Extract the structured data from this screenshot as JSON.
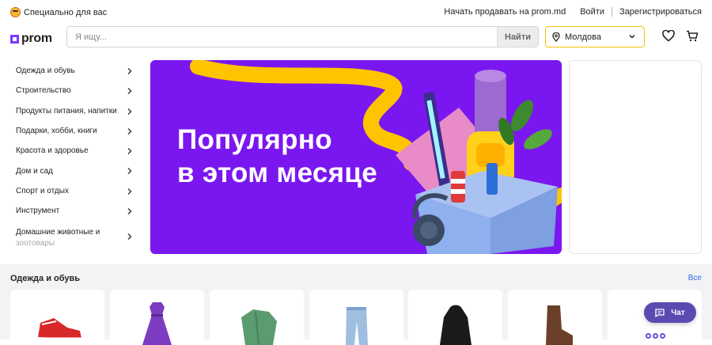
{
  "topbar": {
    "special_label": "Специально для вас",
    "sell_label": "Начать продавать на prom.md",
    "login_label": "Войти",
    "register_label": "Зарегистрироваться"
  },
  "header": {
    "logo_text": "prom",
    "search_placeholder": "Я ищу...",
    "search_button": "Найти",
    "region": "Молдова"
  },
  "categories": [
    {
      "label": "Одежда и обувь"
    },
    {
      "label": "Строительство"
    },
    {
      "label": "Продукты питания, напитки"
    },
    {
      "label": "Подарки, хобби, книги"
    },
    {
      "label": "Красота и здоровье"
    },
    {
      "label": "Дом и сад"
    },
    {
      "label": "Спорт и отдых"
    },
    {
      "label": "Инструмент"
    },
    {
      "label": "Домашние животные и",
      "line2": "зоотовары"
    }
  ],
  "banner": {
    "line1": "Популярно",
    "line2": "в этом месяце"
  },
  "section": {
    "title": "Одежда и обувь",
    "all_link": "Все"
  },
  "products": [
    {
      "icon": "sneaker-icon"
    },
    {
      "icon": "dress-icon"
    },
    {
      "icon": "tracksuit-icon"
    },
    {
      "icon": "jeans-icon"
    },
    {
      "icon": "hoodie-icon"
    },
    {
      "icon": "boots-icon"
    },
    {
      "icon": "product-icon"
    }
  ],
  "chat": {
    "label": "Чат"
  },
  "colors": {
    "brand": "#7a3cff",
    "banner_bg": "#7a17f0",
    "accent_yellow": "#f2c200",
    "link": "#2f6fe0",
    "chat": "#5b4bb0"
  }
}
